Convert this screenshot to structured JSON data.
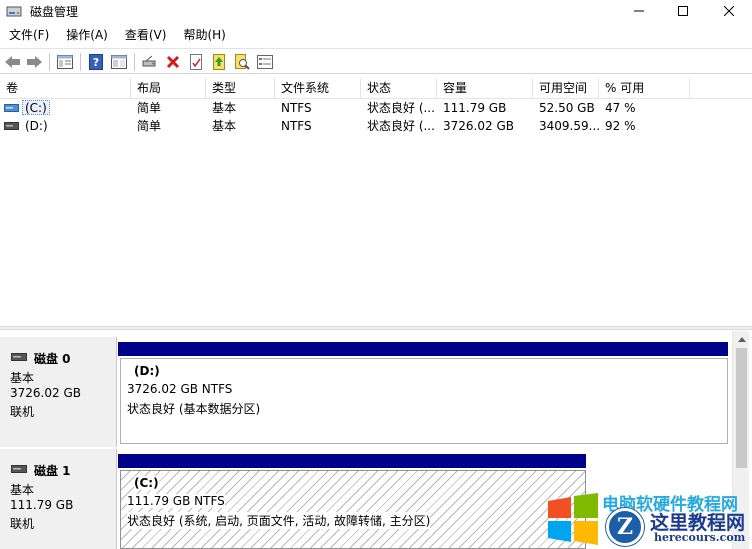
{
  "window": {
    "title": "磁盘管理",
    "minimize_icon": "minimize-icon",
    "maximize_icon": "maximize-icon",
    "close_icon": "close-icon"
  },
  "menu": [
    "文件(F)",
    "操作(A)",
    "查看(V)",
    "帮助(H)"
  ],
  "toolbar": {
    "icons": [
      "back-arrow-icon",
      "forward-arrow-icon",
      "show-hide-console-tree-icon",
      "help-icon",
      "console-view-icon",
      "connect-drive-icon",
      "delete-icon",
      "properties-icon",
      "refresh-up-icon",
      "search-icon",
      "drive-list-icon"
    ]
  },
  "volume_list": {
    "columns": [
      "卷",
      "布局",
      "类型",
      "文件系统",
      "状态",
      "容量",
      "可用空间",
      "% 可用"
    ],
    "rows": [
      {
        "volume": "(C:)",
        "layout": "简单",
        "type": "基本",
        "fs": "NTFS",
        "status": "状态良好 (...",
        "capacity": "111.79 GB",
        "free": "52.50 GB",
        "pct": "47 %"
      },
      {
        "volume": "(D:)",
        "layout": "简单",
        "type": "基本",
        "fs": "NTFS",
        "status": "状态良好 (...",
        "capacity": "3726.02 GB",
        "free": "3409.59...",
        "pct": "92 %"
      }
    ]
  },
  "disks": [
    {
      "name": "磁盘 0",
      "type": "基本",
      "size": "3726.02 GB",
      "status": "联机",
      "partition": {
        "label": "(D:)",
        "size_fs": "3726.02 GB NTFS",
        "status": "状态良好 (基本数据分区)"
      }
    },
    {
      "name": "磁盘 1",
      "type": "基本",
      "size": "111.79 GB",
      "status": "联机",
      "partition": {
        "label": "(C:)",
        "size_fs": "111.79 GB NTFS",
        "status": "状态良好 (系统, 启动, 页面文件, 活动, 故障转储, 主分区)"
      }
    }
  ],
  "colors": {
    "partition_bar": "#00008b",
    "selection": "#e8f1fb"
  },
  "watermark": {
    "headline": "电脑软硬件教程网",
    "brand_cn": "这里教程网",
    "brand_url": "herecours.com",
    "badge_letter": "Z"
  }
}
